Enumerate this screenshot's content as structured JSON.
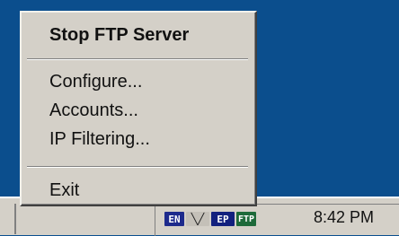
{
  "menu": {
    "stop_server": "Stop FTP Server",
    "configure": "Configure...",
    "accounts": "Accounts...",
    "ip_filtering": "IP Filtering...",
    "exit": "Exit"
  },
  "taskbar": {
    "clock": "8:42 PM",
    "tray_icons": {
      "language": "EN",
      "network": "╲╱",
      "keyboard": "EP",
      "ftp": "FTP"
    }
  },
  "colors": {
    "desktop": "#0b4e8d",
    "menu_bg": "#d4d0c8",
    "text": "#111111"
  }
}
